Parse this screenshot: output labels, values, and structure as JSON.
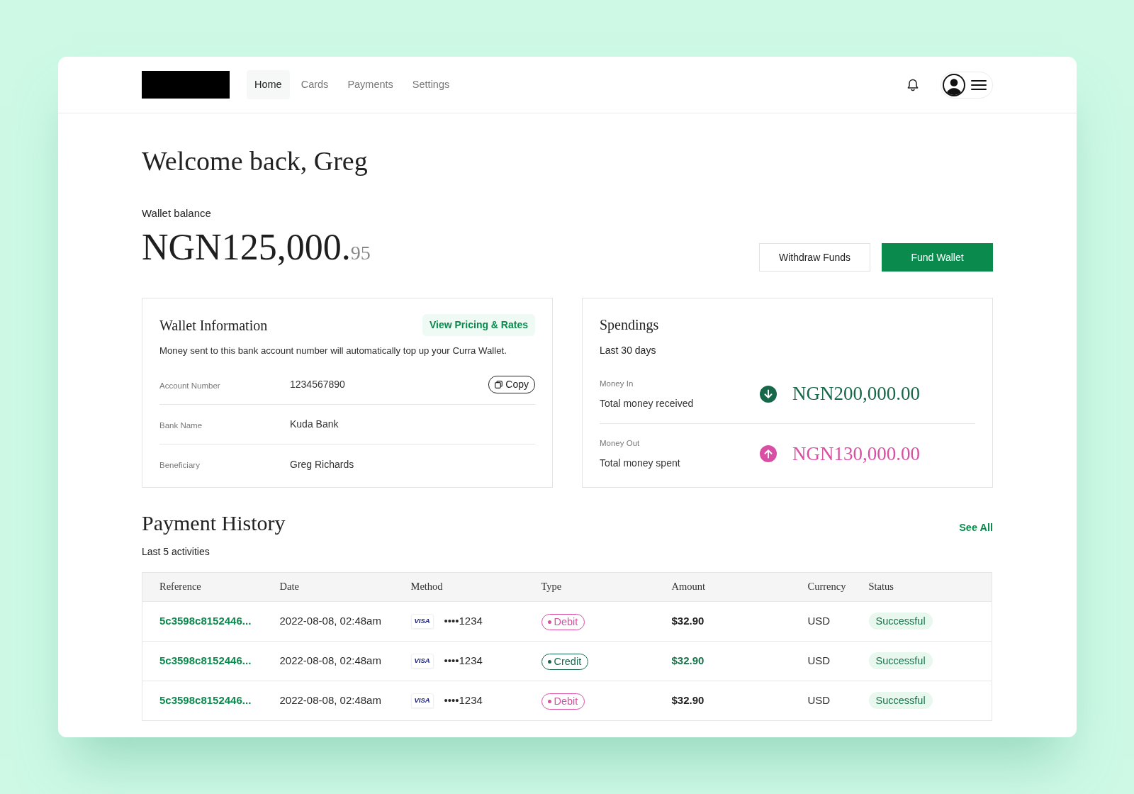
{
  "nav": {
    "items": [
      {
        "label": "Home",
        "selected": true
      },
      {
        "label": "Cards",
        "selected": false
      },
      {
        "label": "Payments",
        "selected": false
      },
      {
        "label": "Settings",
        "selected": false
      }
    ]
  },
  "greeting": "Welcome back, Greg",
  "balance": {
    "label": "Wallet balance",
    "amount": "NGN125,000.",
    "fraction": "95"
  },
  "actions": [
    {
      "label": "Withdraw Funds",
      "kind": "secondary"
    },
    {
      "label": "Fund Wallet",
      "kind": "primary"
    }
  ],
  "wallet_info": {
    "title": "Wallet Information",
    "link": "View Pricing & Rates",
    "description": "Money sent to this bank account number will automatically top up your Curra Wallet.",
    "fields": [
      {
        "label": "Account Number",
        "value": "1234567890",
        "action": "Copy"
      },
      {
        "label": "Bank Name",
        "value": "Kuda Bank"
      },
      {
        "label": "Beneficiary",
        "value": "Greg Richards"
      }
    ]
  },
  "spendings": {
    "title": "Spendings",
    "period": "Last 30 days",
    "items": [
      {
        "label": "Money In",
        "caption": "Total money received",
        "amount": "NGN200,000.00",
        "kind": "in"
      },
      {
        "label": "Money Out",
        "caption": "Total money spent",
        "amount": "NGN130,000.00",
        "kind": "out"
      }
    ]
  },
  "payment_history": {
    "title": "Payment History",
    "link": "See All",
    "subtitle": "Last 5 activities",
    "table": {
      "columns": [
        "Reference",
        "Date",
        "Method",
        "Type",
        "Amount",
        "Currency",
        "Status"
      ],
      "rows": [
        {
          "reference": "5c3598c8152446...",
          "date": "2022-08-08, 02:48am",
          "card_brand": "VISA",
          "card_number": "••••1234",
          "type": {
            "label": "Debit",
            "kind": "debit"
          },
          "amount": "$32.90",
          "currency": "USD",
          "status": {
            "label": "Successful",
            "kind": "success"
          }
        },
        {
          "reference": "5c3598c8152446...",
          "date": "2022-08-08, 02:48am",
          "card_brand": "VISA",
          "card_number": "••••1234",
          "type": {
            "label": "Credit",
            "kind": "credit"
          },
          "amount": "$32.90",
          "currency": "USD",
          "status": {
            "label": "Successful",
            "kind": "success"
          }
        },
        {
          "reference": "5c3598c8152446...",
          "date": "2022-08-08, 02:48am",
          "card_brand": "VISA",
          "card_number": "••••1234",
          "type": {
            "label": "Debit",
            "kind": "debit"
          },
          "amount": "$32.90",
          "currency": "USD",
          "status": {
            "label": "Successful",
            "kind": "success"
          }
        }
      ]
    }
  }
}
